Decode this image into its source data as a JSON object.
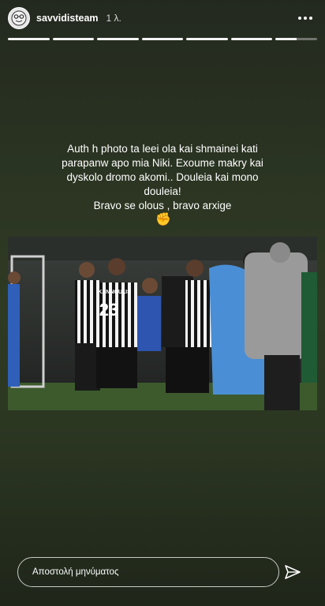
{
  "header": {
    "username": "savvidisteam",
    "time": "1 λ.",
    "more_icon": "more-options-icon"
  },
  "progress": {
    "segments_total": 7,
    "current_segment": 7,
    "current_progress": 0.5
  },
  "caption": {
    "lines": [
      "Auth h photo ta leei ola kai shmainei kati",
      "parapanw apo mia Niki. Exoume makry kai",
      "dyskolo dromo akomi.. Douleia kai mono",
      "douleia!",
      "Bravo se olous , bravo arxige"
    ],
    "emoji": "✊"
  },
  "photo": {
    "player_number": "23",
    "player_name": "KANNOULIS"
  },
  "reply": {
    "placeholder": "Αποστολή μηνύματος",
    "send_icon": "send-icon"
  },
  "colors": {
    "background": "#2c3722",
    "text": "#ffffff"
  }
}
